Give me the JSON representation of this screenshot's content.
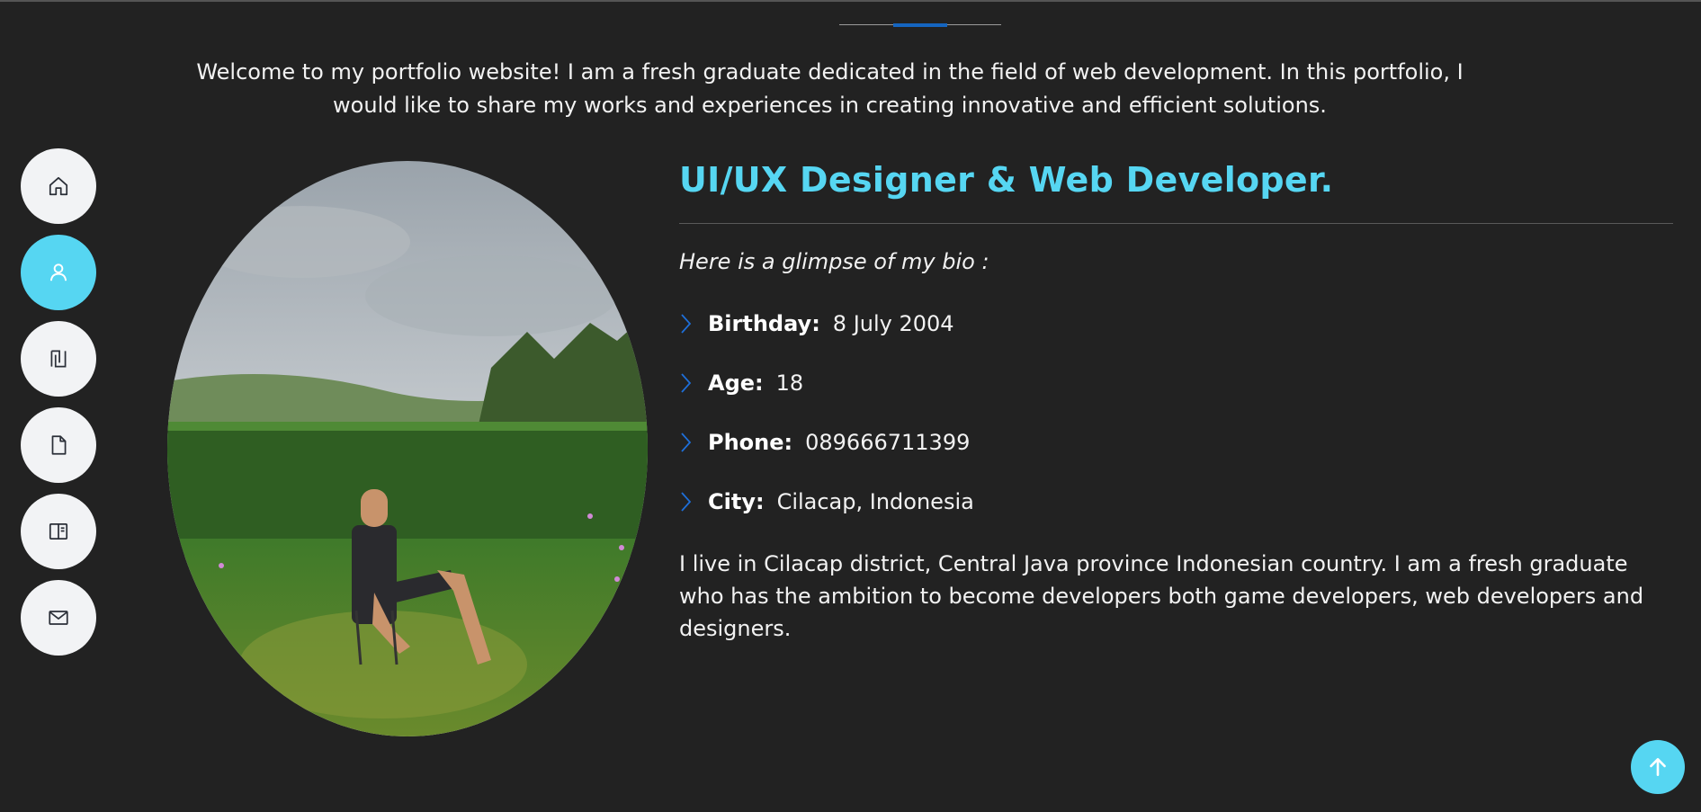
{
  "intro": "Welcome to my portfolio website! I am a fresh graduate dedicated in the field of web development. In this portfolio, I would like to share my works and experiences in creating innovative and efficient solutions.",
  "nav": {
    "items": [
      {
        "icon": "home-icon",
        "active": false
      },
      {
        "icon": "user-icon",
        "active": true
      },
      {
        "icon": "resume-icon",
        "active": false
      },
      {
        "icon": "file-icon",
        "active": false
      },
      {
        "icon": "portfolio-icon",
        "active": false
      },
      {
        "icon": "envelope-icon",
        "active": false
      }
    ]
  },
  "about": {
    "title": "UI/UX Designer & Web Developer.",
    "bio_intro": "Here is a glimpse of my bio :",
    "facts": [
      {
        "label": "Birthday:",
        "value": "8 July 2004"
      },
      {
        "label": "Age:",
        "value": "18"
      },
      {
        "label": "Phone:",
        "value": "089666711399"
      },
      {
        "label": "City:",
        "value": "Cilacap, Indonesia"
      }
    ],
    "description": "I live in Cilacap district, Central Java province Indonesian country. I am a fresh graduate who has the ambition to become developers both game developers, web developers and designers."
  },
  "colors": {
    "accent": "#56d6f2",
    "background": "#222222",
    "divider_accent": "#1565c0"
  },
  "back_to_top": {
    "icon": "arrow-up-icon"
  }
}
